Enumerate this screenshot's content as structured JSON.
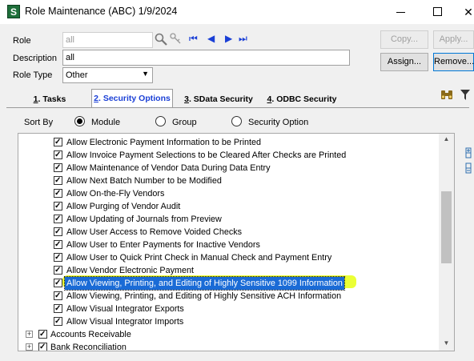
{
  "window": {
    "app_icon_letter": "S",
    "title": "Role Maintenance (ABC) 1/9/2024",
    "minimize_glyph": "—",
    "close_glyph": "✕"
  },
  "form": {
    "role_label": "Role",
    "role_value": "all",
    "description_label": "Description",
    "description_value": "all",
    "role_type_label": "Role Type",
    "role_type_value": "Other"
  },
  "buttons": {
    "copy": "Copy...",
    "apply": "Apply...",
    "assign": "Assign...",
    "remove": "Remove..."
  },
  "nav_icons": {
    "first": "⏮",
    "prev": "◀",
    "next": "▶",
    "last": "⏭"
  },
  "tabs": [
    {
      "num": "1",
      "label": ". Tasks"
    },
    {
      "num": "2",
      "label": ". Security Options"
    },
    {
      "num": "3",
      "label": ". SData Security"
    },
    {
      "num": "4",
      "label": ". ODBC Security"
    }
  ],
  "sort": {
    "label": "Sort By",
    "options": [
      "Module",
      "Group",
      "Security Option"
    ],
    "selected": "Module"
  },
  "tree": {
    "items": [
      "Allow Electronic Payment Information to be Printed",
      "Allow Invoice Payment Selections to be Cleared After Checks are Printed",
      "Allow Maintenance of Vendor Data During Data Entry",
      "Allow Next Batch Number to be Modified",
      "Allow On-the-Fly Vendors",
      "Allow Purging of Vendor Audit",
      "Allow Updating of Journals from Preview",
      "Allow User Access to Remove Voided Checks",
      "Allow User to Enter Payments for Inactive Vendors",
      "Allow User to Quick Print Check in Manual Check and Payment Entry",
      "Allow Vendor Electronic Payment",
      "Allow Viewing, Printing, and Editing of Highly Sensitive 1099 Information",
      "Allow Viewing, Printing, and Editing of Highly Sensitive ACH Information",
      "Allow Visual Integrator Exports",
      "Allow Visual Integrator Imports"
    ],
    "selected_index": 11,
    "modules": [
      "Accounts Receivable",
      "Bank Reconciliation"
    ]
  },
  "colors": {
    "selection": "#1a6bd6",
    "marker": "#eaff2a",
    "nav_blue": "#1a3fd6"
  }
}
